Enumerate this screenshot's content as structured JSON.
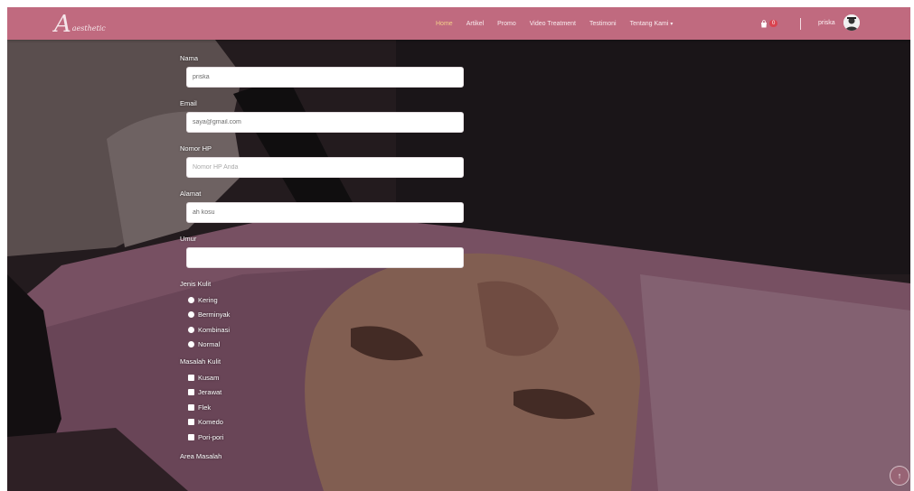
{
  "brand": {
    "logo_big": "A",
    "logo_small": "aesthetic"
  },
  "nav": {
    "items": [
      {
        "label": "Home",
        "active": true
      },
      {
        "label": "Artikel",
        "active": false
      },
      {
        "label": "Promo",
        "active": false
      },
      {
        "label": "Video Treatment",
        "active": false
      },
      {
        "label": "Testimoni",
        "active": false
      },
      {
        "label": "Tentang Kami",
        "active": false
      }
    ],
    "dropdown_caret": "▾",
    "cart_icon": "bag-icon",
    "cart_count": "0",
    "user_name": "priska"
  },
  "form": {
    "nama": {
      "label": "Nama",
      "value": "priska",
      "placeholder": ""
    },
    "email": {
      "label": "Email",
      "value": "saya@gmail.com",
      "placeholder": ""
    },
    "hp": {
      "label": "Nomor HP",
      "value": "",
      "placeholder": "Nomor HP Anda"
    },
    "alamat": {
      "label": "Alamat",
      "value": "ah kosu",
      "placeholder": ""
    },
    "umur": {
      "label": "Umur",
      "value": "",
      "placeholder": ""
    },
    "jenis_kulit": {
      "label": "Jenis Kulit",
      "options": [
        "Kering",
        "Berminyak",
        "Kombinasi",
        "Normal"
      ]
    },
    "masalah_kulit": {
      "label": "Masalah Kulit",
      "options": [
        "Kusam",
        "Jerawat",
        "Flek",
        "Komedo",
        "Pori-pori"
      ]
    },
    "area_masalah": {
      "label": "Area Masalah"
    }
  },
  "scroll_top_icon": "↑",
  "colors": {
    "navbar": "#c06a7f",
    "active_link": "#f4d08a",
    "badge": "#d9434f"
  }
}
